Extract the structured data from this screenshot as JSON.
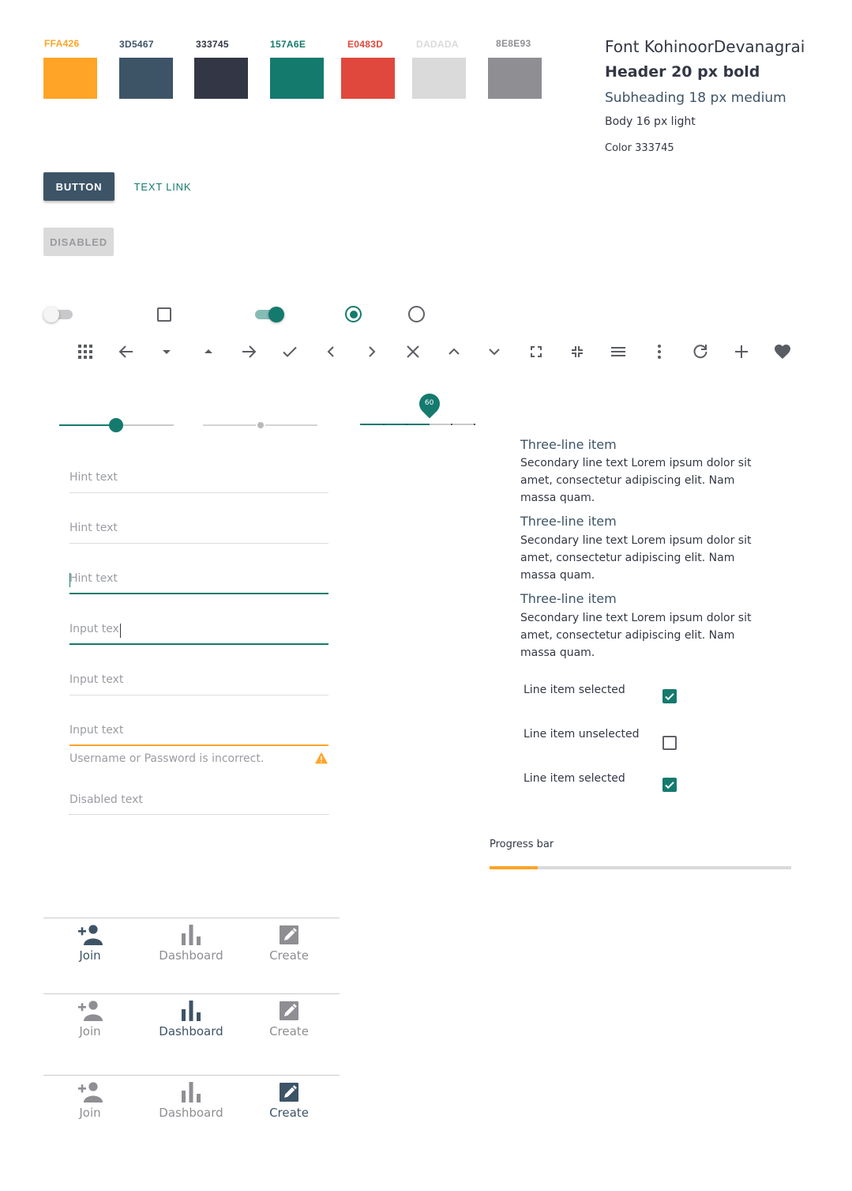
{
  "palette": [
    {
      "hex": "FFA426",
      "color": "#FFA426"
    },
    {
      "hex": "3D5467",
      "color": "#3D5467"
    },
    {
      "hex": "333745",
      "color": "#333745"
    },
    {
      "hex": "157A6E",
      "color": "#157A6E"
    },
    {
      "hex": "E0483D",
      "color": "#E0483D"
    },
    {
      "hex": "DADADA",
      "color": "#DADADA"
    },
    {
      "hex": "8E8E93",
      "color": "#8E8E93"
    }
  ],
  "typography": {
    "font": "Font KohinoorDevanagrai",
    "header": "Header 20 px bold",
    "subheading": "Subheading 18 px medium",
    "body": "Body 16 px light",
    "color": "Color 333745"
  },
  "buttons": {
    "primary": "BUTTON",
    "text_link": "TEXT LINK",
    "disabled": "DISABLED"
  },
  "controls": {
    "toggle_off": false,
    "checkbox_checked": false,
    "toggle_on": true,
    "radio_selected": true,
    "radio_unselected": false
  },
  "icons": [
    "apps-icon",
    "arrow-back-icon",
    "caret-down-icon",
    "caret-up-icon",
    "arrow-forward-icon",
    "check-icon",
    "chevron-left-icon",
    "chevron-right-icon",
    "close-icon",
    "chevron-up-icon",
    "chevron-down-icon",
    "fullscreen-icon",
    "fullscreen-exit-icon",
    "menu-icon",
    "more-vert-icon",
    "refresh-icon",
    "add-icon",
    "heart-icon"
  ],
  "sliders": {
    "continuous_value": 50,
    "disabled_value": 50,
    "discrete_value": 60,
    "discrete_label": "60"
  },
  "fields": [
    {
      "text": "Hint text",
      "state": "default"
    },
    {
      "text": "Hint text",
      "state": "default"
    },
    {
      "text": "Hint text",
      "state": "focused"
    },
    {
      "text": "Input tex",
      "state": "typing"
    },
    {
      "text": "Input text",
      "state": "filled"
    },
    {
      "text": "Input text",
      "state": "error",
      "error": "Username or Password is incorrect."
    },
    {
      "text": "Disabled text",
      "state": "disabled"
    }
  ],
  "list": [
    {
      "title": "Three-line item",
      "secondary": "Secondary line text Lorem ipsum dolor sit amet, consectetur adipiscing elit. Nam massa quam."
    },
    {
      "title": "Three-line item",
      "secondary": "Secondary line text Lorem ipsum dolor sit amet, consectetur adipiscing elit. Nam massa quam."
    },
    {
      "title": "Three-line item",
      "secondary": "Secondary line text Lorem ipsum dolor sit amet, consectetur adipiscing elit. Nam massa quam."
    }
  ],
  "line_items": [
    {
      "label": "Line item selected",
      "checked": true
    },
    {
      "label": "Line item unselected",
      "checked": false
    },
    {
      "label": "Line item selected",
      "checked": true
    }
  ],
  "progress": {
    "label": "Progress bar",
    "value": 0.16
  },
  "bottom_navs": [
    {
      "active": 0,
      "items": [
        "Join",
        "Dashboard",
        "Create"
      ]
    },
    {
      "active": 1,
      "items": [
        "Join",
        "Dashboard",
        "Create"
      ]
    },
    {
      "active": 2,
      "items": [
        "Join",
        "Dashboard",
        "Create"
      ]
    }
  ],
  "colors": {
    "accent": "#157A6E",
    "primary": "#3D5467",
    "warning": "#FFA426",
    "inactive": "#8E8E93",
    "disabled": "#DADADA"
  }
}
